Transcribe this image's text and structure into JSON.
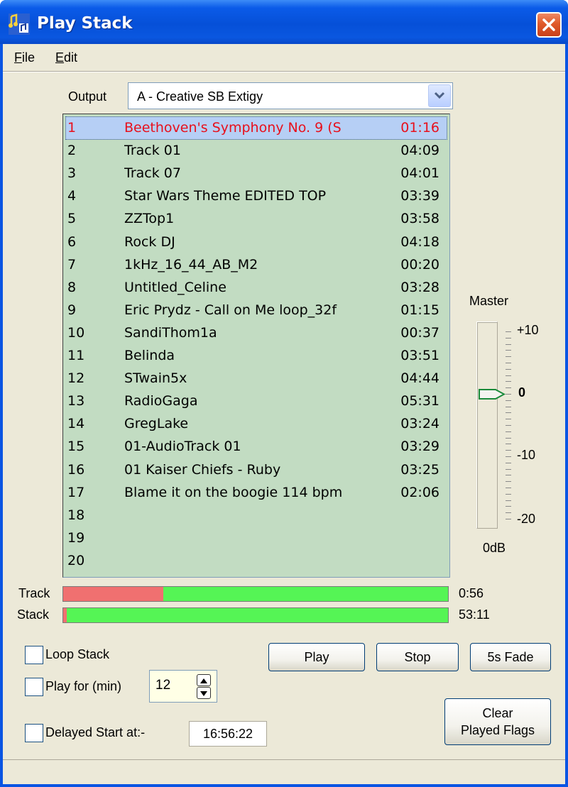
{
  "window": {
    "title": "Play Stack"
  },
  "menu": {
    "file": "File",
    "file_key": "F",
    "file_rest": "ile",
    "edit": "Edit",
    "edit_key": "E",
    "edit_rest": "dit"
  },
  "output": {
    "label": "Output",
    "selected": "A - Creative SB Extigy"
  },
  "playlist": [
    {
      "num": "1",
      "name": "Beethoven's Symphony No. 9 (S",
      "time": "01:16",
      "selected": true
    },
    {
      "num": "2",
      "name": "Track 01",
      "time": "04:09"
    },
    {
      "num": "3",
      "name": "Track 07",
      "time": "04:01"
    },
    {
      "num": "4",
      "name": "Star Wars Theme EDITED TOP",
      "time": "03:39"
    },
    {
      "num": "5",
      "name": "ZZTop1",
      "time": "03:58"
    },
    {
      "num": "6",
      "name": "Rock DJ",
      "time": "04:18"
    },
    {
      "num": "7",
      "name": "1kHz_16_44_AB_M2",
      "time": "00:20"
    },
    {
      "num": "8",
      "name": "Untitled_Celine",
      "time": "03:28"
    },
    {
      "num": "9",
      "name": "Eric Prydz - Call on Me loop_32f",
      "time": "01:15"
    },
    {
      "num": "10",
      "name": "SandiThom1a",
      "time": "00:37"
    },
    {
      "num": "11",
      "name": "Belinda",
      "time": "03:51"
    },
    {
      "num": "12",
      "name": "STwain5x",
      "time": "04:44"
    },
    {
      "num": "13",
      "name": "RadioGaga",
      "time": "05:31"
    },
    {
      "num": "14",
      "name": "GregLake",
      "time": "03:24"
    },
    {
      "num": "15",
      "name": "01-AudioTrack 01",
      "time": "03:29"
    },
    {
      "num": "16",
      "name": "01  Kaiser Chiefs - Ruby",
      "time": "03:25"
    },
    {
      "num": "17",
      "name": "Blame it on the boogie 114 bpm",
      "time": "02:06"
    },
    {
      "num": "18",
      "name": "",
      "time": ""
    },
    {
      "num": "19",
      "name": "",
      "time": ""
    },
    {
      "num": "20",
      "name": "",
      "time": ""
    }
  ],
  "master": {
    "label": "Master",
    "scale": [
      "+10",
      "0",
      "-10",
      "-20"
    ],
    "value": "0dB",
    "level_db": 0
  },
  "progress": {
    "track": {
      "label": "Track",
      "time": "0:56",
      "fraction": 0.26
    },
    "stack": {
      "label": "Stack",
      "time": "53:11",
      "fraction": 0.01
    }
  },
  "options": {
    "loop_stack": {
      "label": "Loop Stack",
      "checked": false
    },
    "play_for": {
      "label": "Play for (min)",
      "checked": false,
      "value": "12"
    },
    "delayed_start": {
      "label": "Delayed Start at:-",
      "checked": false,
      "value": "16:56:22"
    }
  },
  "buttons": {
    "play": "Play",
    "stop": "Stop",
    "fade": "5s Fade",
    "clear_line1": "Clear",
    "clear_line2": "Played Flags"
  },
  "colors": {
    "titlebar": "#0a55e3",
    "playlist_bg": "#c2dcc2",
    "selected_text": "#e8101c",
    "progress_played": "#f07070",
    "progress_remaining": "#55f555"
  }
}
